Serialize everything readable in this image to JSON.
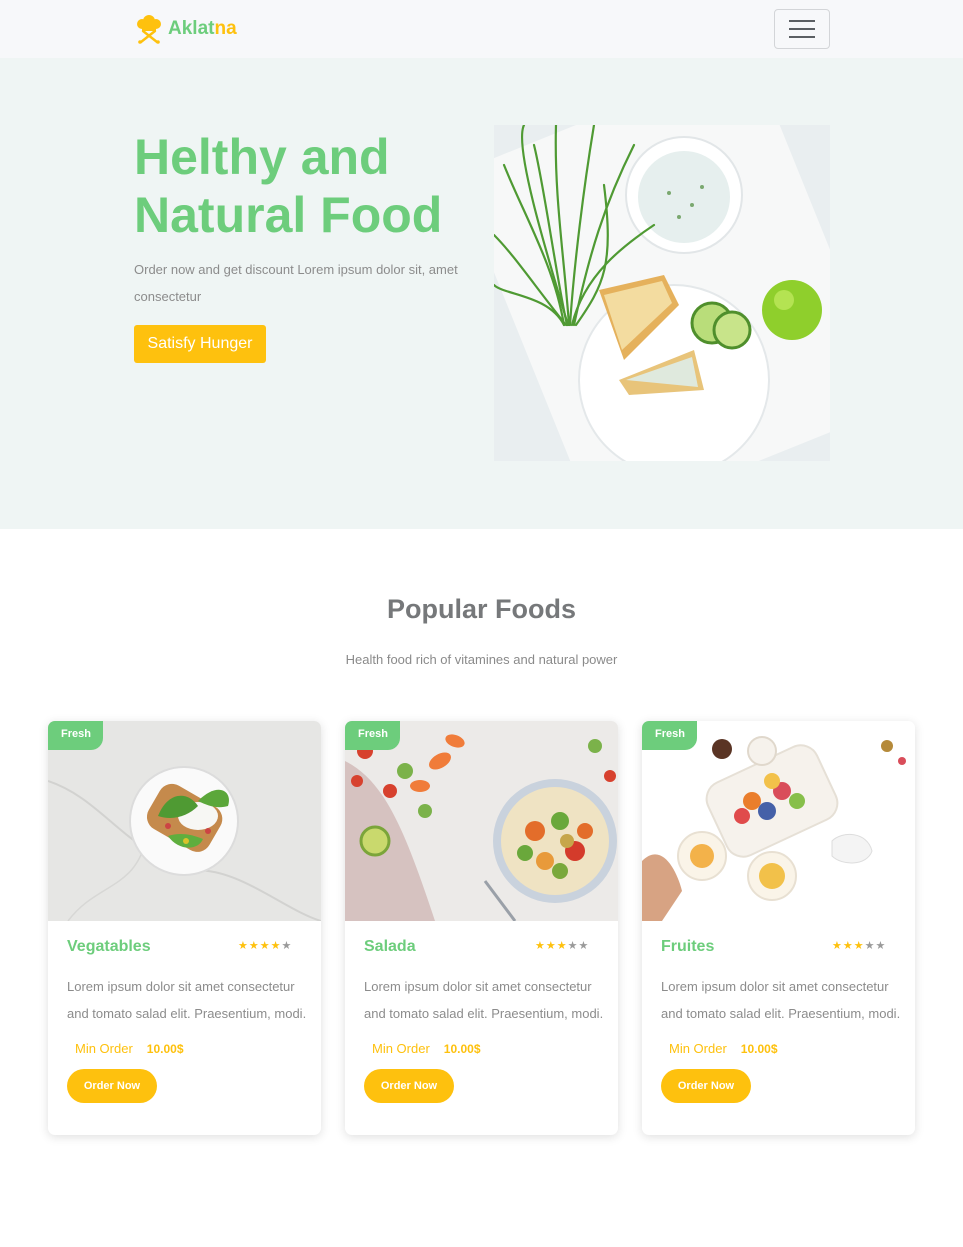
{
  "navbar": {
    "brand_part1": "Aklat",
    "brand_part2": "na",
    "logo_icon": "chef-hat-cutlery-icon",
    "menu_icon": "hamburger-menu-icon"
  },
  "hero": {
    "title": "Helthy and Natural Food",
    "text": "Order now and get discount Lorem ipsum dolor sit, amet consectetur",
    "button_label": "Satisfy Hunger"
  },
  "popular": {
    "title": "Popular Foods",
    "subtitle": "Health food rich of vitamines and natural power",
    "cards": [
      {
        "badge": "Fresh",
        "title": "Vegatables",
        "rating": 4,
        "rating_max": 5,
        "text": "Lorem ipsum dolor sit amet consectetur and tomato salad elit. Praesentium, modi.",
        "min_label": "Min Order",
        "min_value": "10.00$",
        "button_label": "Order Now"
      },
      {
        "badge": "Fresh",
        "title": "Salada",
        "rating": 3,
        "rating_max": 5,
        "text": "Lorem ipsum dolor sit amet consectetur and tomato salad elit. Praesentium, modi.",
        "min_label": "Min Order",
        "min_value": "10.00$",
        "button_label": "Order Now"
      },
      {
        "badge": "Fresh",
        "title": "Fruites",
        "rating": 3,
        "rating_max": 5,
        "text": "Lorem ipsum dolor sit amet consectetur and tomato salad elit. Praesentium, modi.",
        "min_label": "Min Order",
        "min_value": "10.00$",
        "button_label": "Order Now"
      }
    ]
  },
  "colors": {
    "brand_green": "#6dcd7c",
    "accent_yellow": "#fec10e",
    "hero_bg": "#eff5f4",
    "navbar_bg": "#f7f8fa"
  }
}
